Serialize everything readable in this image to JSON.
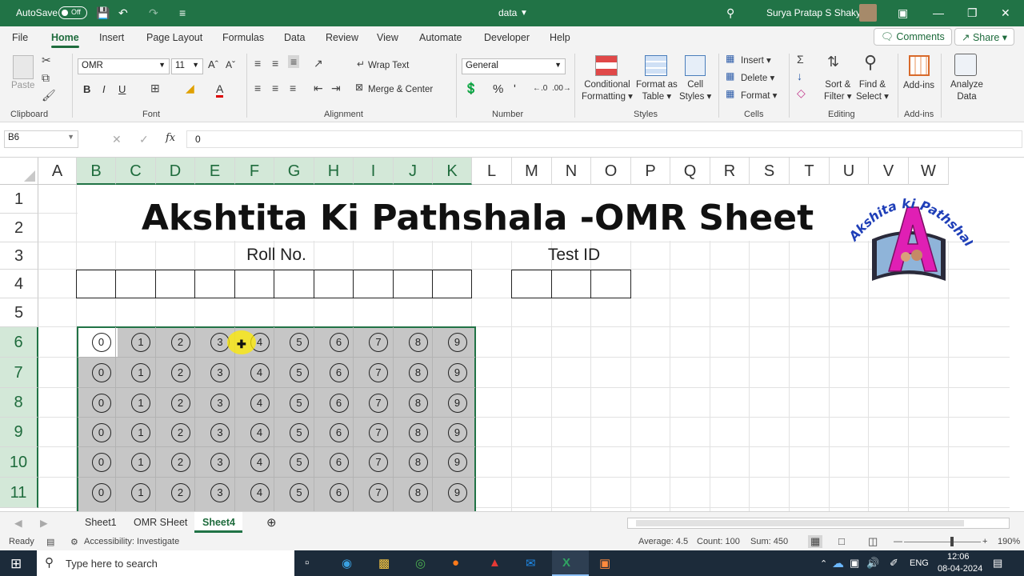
{
  "titlebar": {
    "autosave_label": "AutoSave",
    "autosave_state": "Off",
    "doc_name": "data",
    "user_name": "Surya Pratap S Shakya"
  },
  "menu": {
    "tabs": [
      "File",
      "Home",
      "Insert",
      "Page Layout",
      "Formulas",
      "Data",
      "Review",
      "View",
      "Automate",
      "Developer",
      "Help"
    ],
    "active": "Home",
    "comments": "Comments",
    "share": "Share"
  },
  "ribbon": {
    "clipboard": {
      "paste": "Paste",
      "label": "Clipboard"
    },
    "font": {
      "name": "OMR",
      "size": "11",
      "label": "Font"
    },
    "alignment": {
      "wrap": "Wrap Text",
      "merge": "Merge & Center",
      "label": "Alignment"
    },
    "number": {
      "format": "General",
      "label": "Number"
    },
    "styles": {
      "cond1": "Conditional",
      "cond2": "Formatting",
      "fmt1": "Format as",
      "fmt2": "Table",
      "cell1": "Cell",
      "cell2": "Styles",
      "label": "Styles"
    },
    "cells": {
      "insert": "Insert",
      "delete": "Delete",
      "format": "Format",
      "label": "Cells"
    },
    "editing": {
      "sort1": "Sort &",
      "sort2": "Filter",
      "find1": "Find &",
      "find2": "Select",
      "label": "Editing"
    },
    "addins": {
      "name": "Add-ins",
      "label": "Add-ins"
    },
    "analyze": {
      "l1": "Analyze",
      "l2": "Data"
    }
  },
  "formula_bar": {
    "name_box": "B6",
    "fx": "fx",
    "value": "0"
  },
  "columns": [
    "A",
    "B",
    "C",
    "D",
    "E",
    "F",
    "G",
    "H",
    "I",
    "J",
    "K",
    "L",
    "M",
    "N",
    "O",
    "P",
    "Q",
    "R",
    "S",
    "T",
    "U",
    "V",
    "W"
  ],
  "rows": [
    "1",
    "2",
    "3",
    "4",
    "5",
    "6",
    "7",
    "8",
    "9",
    "10",
    "11"
  ],
  "sheet": {
    "title": "Akshtita Ki Pathshala -OMR Sheet",
    "roll_label": "Roll No.",
    "test_label": "Test ID",
    "logo_text": "Akshita ki Pathshala",
    "logo_letter": "A",
    "bubbles": [
      "0",
      "1",
      "2",
      "3",
      "4",
      "5",
      "6",
      "7",
      "8",
      "9"
    ]
  },
  "sheet_tabs": {
    "tabs": [
      "Sheet1",
      "OMR SHeet",
      "Sheet4"
    ],
    "active": "Sheet4"
  },
  "status": {
    "ready": "Ready",
    "accessibility": "Accessibility: Investigate",
    "average": "Average: 4.5",
    "count": "Count: 100",
    "sum": "Sum: 450",
    "zoom": "190%"
  },
  "taskbar": {
    "search_placeholder": "Type here to search",
    "lang": "ENG",
    "time": "12:06",
    "date": "08-04-2024"
  },
  "colors": {
    "excel_green": "#217346",
    "selected_fill": "#c6c6c6",
    "logo_magenta": "#e01fb4",
    "logo_blue": "#1f3fb8"
  }
}
